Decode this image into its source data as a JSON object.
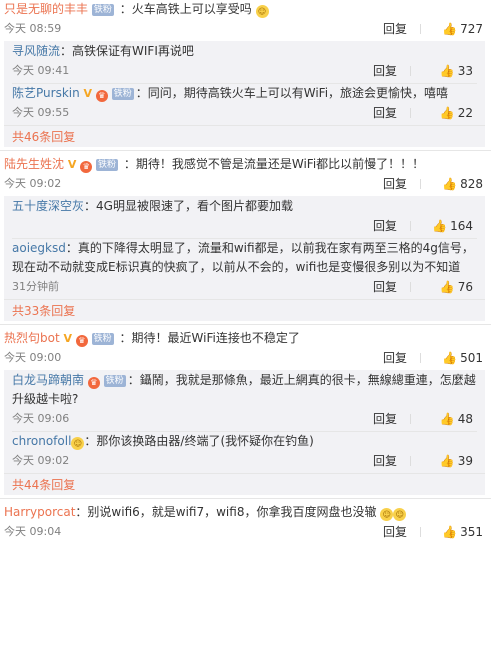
{
  "comments": [
    {
      "user": "只是无聊的丰丰",
      "text": "：火车高铁上可以享受吗",
      "time": "今天 08:59",
      "reply": "回复",
      "likes": "727",
      "replies": [
        {
          "user": "寻风随流",
          "text": "：高铁保证有WIFI再说吧",
          "time": "今天 09:41",
          "reply": "回复",
          "likes": "33"
        },
        {
          "user": "陈艺Purskin",
          "text": "：同问，期待高铁火车上可以有WiFi，旅途会更愉快，嘻嘻",
          "time": "今天 09:55",
          "reply": "回复",
          "likes": "22"
        }
      ],
      "more": "共46条回复"
    },
    {
      "user": "陆先生姓沈",
      "text": "：期待！我感觉不管是流量还是WiFi都比以前慢了！！！",
      "time": "今天 09:02",
      "reply": "回复",
      "likes": "828",
      "replies": [
        {
          "user": "五十度深空灰",
          "text": "：4G明显被限速了，看个图片都要加载",
          "time": "",
          "reply": "回复",
          "likes": "164"
        },
        {
          "user": "aoiegksd",
          "text": "：真的下降得太明显了，流量和wifi都是，以前我在家有两至三格的4g信号，现在动不动就变成E标识真的快疯了，以前从不会的，wifi也是变慢很多别以为不知道",
          "time": "31分钟前",
          "reply": "回复",
          "likes": "76"
        }
      ],
      "more": "共33条回复"
    },
    {
      "user": "热烈句bot",
      "text": "：期待！最近WiFi连接也不稳定了",
      "time": "今天 09:00",
      "reply": "回复",
      "likes": "501",
      "replies": [
        {
          "user": "白龙马蹄朝南",
          "text": "：鑷鬧，我就是那條魚，最近上網真的很卡，無線總重連，怎麼越升級越卡啦?",
          "time": "今天 09:06",
          "reply": "回复",
          "likes": "48"
        },
        {
          "user": "chronofoll",
          "text": "：那你该换路由器/终端了(我怀疑你在钓鱼)",
          "time": "今天 09:02",
          "reply": "回复",
          "likes": "39"
        }
      ],
      "more": "共44条回复"
    },
    {
      "user": "Harryporcat",
      "text": "：别说wifi6，就是wifi7，wifi8，你拿我百度网盘也没辙",
      "time": "今天 09:04",
      "reply": "回复",
      "likes": "351"
    }
  ],
  "icons": {
    "thumb": "thumbs-up-icon",
    "badge": "level-badge-icon",
    "vip": "vip-v-icon",
    "crown": "member-crown-icon",
    "emoji": "emoji-icon"
  },
  "badge_text": "铁粉"
}
